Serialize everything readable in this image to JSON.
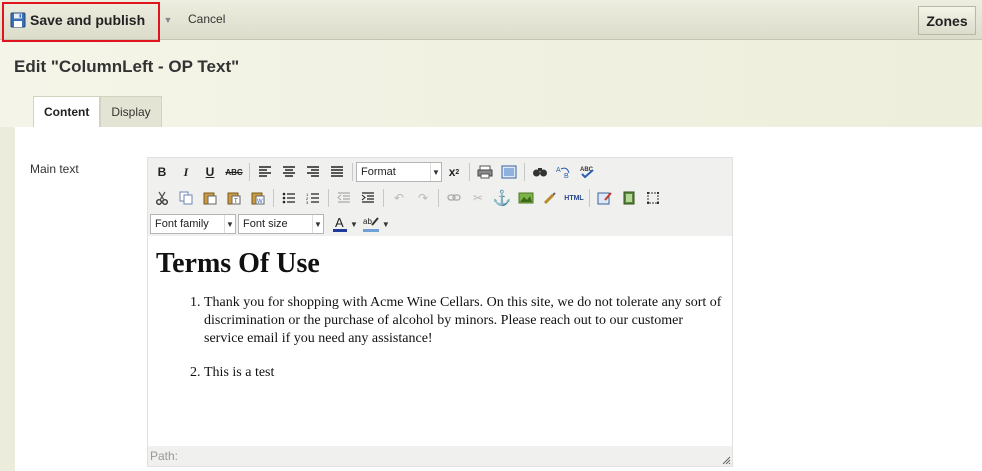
{
  "toolbar": {
    "save_label": "Save and publish",
    "cancel_label": "Cancel",
    "zones_label": "Zones"
  },
  "page": {
    "title": "Edit \"ColumnLeft - OP Text\"",
    "tabs": [
      {
        "label": "Content",
        "active": true
      },
      {
        "label": "Display",
        "active": false
      }
    ]
  },
  "form": {
    "main_text_label": "Main text"
  },
  "editor": {
    "format_select": "Format",
    "font_family_select": "Font family",
    "font_size_select": "Font size",
    "heading": "Terms Of Use",
    "items": [
      "Thank you for shopping with Acme Wine Cellars. On this site, we do not tolerate any sort of discrimination or the purchase of alcohol by minors. Please reach out to our customer service email if you need any assistance!",
      "This is a test"
    ],
    "path_label": "Path:"
  },
  "colors": {
    "highlight_border": "#e0141e",
    "text_color_bar": "#1f3c9c",
    "bg_color_bar": "#6fa0d8"
  }
}
